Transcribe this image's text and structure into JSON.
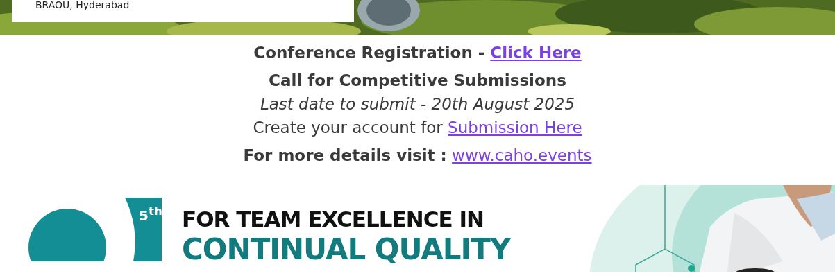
{
  "header": {
    "card_text": "BRAOU, Hyderabad"
  },
  "registration": {
    "label": "Conference Registration - ",
    "link": "Click Here"
  },
  "submissions": {
    "title": "Call for Competitive Submissions",
    "deadline": "Last date to submit - 20th August 2025",
    "account_text": "Create your account for ",
    "account_link": "Submission Here"
  },
  "details": {
    "label": "For more details visit :",
    "link": "www.caho.events"
  },
  "banner": {
    "edition": "5$^{th}$",
    "line_1": "FOR TEAM EXCELLENCE IN",
    "line_2": "CONTINUAL QUALITY"
  }
}
